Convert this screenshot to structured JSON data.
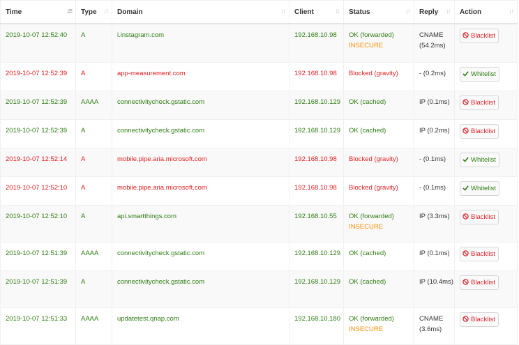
{
  "headers": [
    {
      "label": "Time",
      "sort_icon": "sort-desc-icon"
    },
    {
      "label": "Type",
      "sort_icon": "sort-icon"
    },
    {
      "label": "Domain",
      "sort_icon": "sort-icon"
    },
    {
      "label": "Client",
      "sort_icon": "sort-icon"
    },
    {
      "label": "Status",
      "sort_icon": "sort-icon"
    },
    {
      "label": "Reply",
      "sort_icon": "sort-icon"
    },
    {
      "label": "Action",
      "sort_icon": "sort-icon"
    }
  ],
  "colors": {
    "allowed": "#2e7d12",
    "blocked": "#e02020",
    "insecure": "#ff8c00",
    "blacklist_button": "#d9262c",
    "whitelist_button": "#2e7d12"
  },
  "rows": [
    {
      "time": "2019-10-07 12:52:40",
      "type": "A",
      "domain": "i.instagram.com",
      "client": "192.168.10.98",
      "status": "OK (forwarded)",
      "dnssec": "INSECURE",
      "reply": "CNAME (54.2ms)",
      "action": "Blacklist",
      "action_icon": "ban-icon",
      "state": "allowed"
    },
    {
      "time": "2019-10-07 12:52:39",
      "type": "A",
      "domain": "app-measurement.com",
      "client": "192.168.10.98",
      "status": "Blocked (gravity)",
      "dnssec": "",
      "reply": "- (0.2ms)",
      "action": "Whitelist",
      "action_icon": "check-icon",
      "state": "blocked"
    },
    {
      "time": "2019-10-07 12:52:39",
      "type": "AAAA",
      "domain": "connectivitycheck.gstatic.com",
      "client": "192.168.10.129",
      "status": "OK (cached)",
      "dnssec": "",
      "reply": "IP (0.1ms)",
      "action": "Blacklist",
      "action_icon": "ban-icon",
      "state": "allowed"
    },
    {
      "time": "2019-10-07 12:52:39",
      "type": "A",
      "domain": "connectivitycheck.gstatic.com",
      "client": "192.168.10.129",
      "status": "OK (cached)",
      "dnssec": "",
      "reply": "IP (0.2ms)",
      "action": "Blacklist",
      "action_icon": "ban-icon",
      "state": "allowed"
    },
    {
      "time": "2019-10-07 12:52:14",
      "type": "A",
      "domain": "mobile.pipe.aria.microsoft.com",
      "client": "192.168.10.98",
      "status": "Blocked (gravity)",
      "dnssec": "",
      "reply": "- (0.1ms)",
      "action": "Whitelist",
      "action_icon": "check-icon",
      "state": "blocked"
    },
    {
      "time": "2019-10-07 12:52:10",
      "type": "A",
      "domain": "mobile.pipe.aria.microsoft.com",
      "client": "192.168.10.98",
      "status": "Blocked (gravity)",
      "dnssec": "",
      "reply": "- (0.1ms)",
      "action": "Whitelist",
      "action_icon": "check-icon",
      "state": "blocked"
    },
    {
      "time": "2019-10-07 12:52:10",
      "type": "A",
      "domain": "api.smartthings.com",
      "client": "192.168.10.55",
      "status": "OK (forwarded)",
      "dnssec": "INSECURE",
      "reply": "IP (3.3ms)",
      "action": "Blacklist",
      "action_icon": "ban-icon",
      "state": "allowed"
    },
    {
      "time": "2019-10-07 12:51:39",
      "type": "AAAA",
      "domain": "connectivitycheck.gstatic.com",
      "client": "192.168.10.129",
      "status": "OK (cached)",
      "dnssec": "",
      "reply": "IP (0.1ms)",
      "action": "Blacklist",
      "action_icon": "ban-icon",
      "state": "allowed"
    },
    {
      "time": "2019-10-07 12:51:39",
      "type": "A",
      "domain": "connectivitycheck.gstatic.com",
      "client": "192.168.10.129",
      "status": "OK (cached)",
      "dnssec": "",
      "reply": "IP (10.4ms)",
      "action": "Blacklist",
      "action_icon": "ban-icon",
      "state": "allowed"
    },
    {
      "time": "2019-10-07 12:51:33",
      "type": "AAAA",
      "domain": "updatetest.qnap.com",
      "client": "192.168.10.180",
      "status": "OK (forwarded)",
      "dnssec": "INSECURE",
      "reply": "CNAME (3.6ms)",
      "action": "Blacklist",
      "action_icon": "ban-icon",
      "state": "allowed"
    }
  ]
}
